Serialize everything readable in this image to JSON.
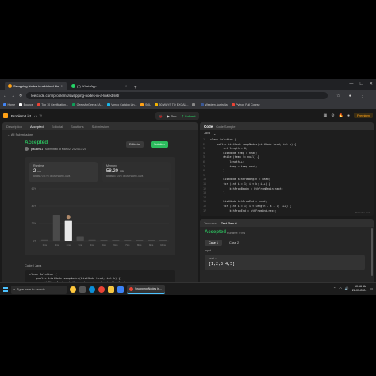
{
  "browser": {
    "tabs": [
      {
        "label": "Swapping Nodes in a Linked List",
        "active": true,
        "color": "#ffa116"
      },
      {
        "label": "(7) WhatsApp",
        "active": false,
        "color": "#25d366"
      }
    ],
    "new_tab": "+",
    "url": "leetcode.com/problems/swapping-nodes-in-a-linked-list/",
    "bookmarks": [
      {
        "label": "Home",
        "color": "#4285f4"
      },
      {
        "label": "Bounce",
        "color": "#ffffff"
      },
      {
        "label": "Top 10 Certification...",
        "color": "#ea4335"
      },
      {
        "label": "GeeksforGeeks | A...",
        "color": "#0f9d58"
      },
      {
        "label": "Vimeo Catalog Lin...",
        "color": "#1ab7ea"
      },
      {
        "label": "SQL",
        "color": "#ffa116"
      },
      {
        "label": "50 WAYS TO EXCAL...",
        "color": "#f4b400"
      },
      {
        "label": "",
        "color": "#888888"
      },
      {
        "label": "Western Australia",
        "color": "#3b5998"
      },
      {
        "label": "Python Full Course",
        "color": "#ea4335"
      }
    ]
  },
  "leetcode": {
    "problem_list": "Problem List",
    "run": "Run",
    "submit": "Submit",
    "premium": "Premium"
  },
  "left_panel": {
    "tabs": [
      "Description",
      "Accepted",
      "Editorial",
      "Solutions",
      "Submissions"
    ],
    "active_tab": 1,
    "all_submissions": "← All Submissions",
    "status": "Accepted",
    "author": "pisukm11",
    "submitted_at": "submitted at Mar 02, 2024 13:20",
    "editorial_btn": "Editorial",
    "solution_btn": "Solution",
    "runtime_label": "Runtime",
    "runtime_value": "2",
    "runtime_unit": "ms",
    "runtime_beats": "Beats 70.97% of users with Java",
    "memory_label": "Memory",
    "memory_value": "58.20",
    "memory_unit": "MB",
    "memory_beats": "Beats 87.04% of users with Java",
    "code_header": "Code | Java",
    "code_lines": [
      "class Solution {",
      "    public ListNode swapNodes(ListNode head, int k) {",
      "        // Step 1: Count the number of nodes in the list",
      "        int length = 0;",
      "        ListNode temp = head;",
      "        while (temp != null) {",
      "            length++;",
      "            temp = temp.next;"
    ]
  },
  "chart_data": {
    "type": "bar",
    "categories": [
      "0ms",
      "1ms",
      "2ms",
      "3ms",
      "4ms",
      "5ms",
      "6ms",
      "7ms",
      "8ms",
      "9ms",
      "10ms"
    ],
    "values": [
      2,
      30,
      24,
      5,
      2,
      1,
      1,
      1,
      1,
      1,
      1
    ],
    "highlight_index": 2,
    "yticks": [
      "60%",
      "40%",
      "20%",
      "0%"
    ],
    "ylim": [
      0,
      60
    ]
  },
  "code_panel": {
    "title": "Code",
    "subtitle": "Code Sample",
    "language": "Java",
    "saved": "Saved to local",
    "lines": [
      {
        "n": "1",
        "t": "class Solution {"
      },
      {
        "n": "2",
        "t": "    public ListNode swapNodes(ListNode head, int k) {"
      },
      {
        "n": "3",
        "t": "        int length = 0;"
      },
      {
        "n": "4",
        "t": "        ListNode temp = head;"
      },
      {
        "n": "5",
        "t": "        while (temp != null) {"
      },
      {
        "n": "6",
        "t": "            length++;"
      },
      {
        "n": "7",
        "t": "            temp = temp.next;"
      },
      {
        "n": "8",
        "t": "        }"
      },
      {
        "n": "9",
        "t": ""
      },
      {
        "n": "10",
        "t": "        ListNode kthFromBegin = head;"
      },
      {
        "n": "11",
        "t": "        for (int i = 1; i < k; i++) {"
      },
      {
        "n": "12",
        "t": "            kthFromBegin = kthFromBegin.next;"
      },
      {
        "n": "13",
        "t": "        }"
      },
      {
        "n": "14",
        "t": ""
      },
      {
        "n": "15",
        "t": "        ListNode kthFromEnd = head;"
      },
      {
        "n": "16",
        "t": "        for (int i = 1; i < length - k + 1; i++) {"
      },
      {
        "n": "17",
        "t": "            kthFromEnd = kthFromEnd.next;"
      }
    ]
  },
  "test_panel": {
    "tabs": [
      "Testcase",
      "Test Result"
    ],
    "active_tab": 1,
    "status": "Accepted",
    "runtime": "Runtime: 0 ms",
    "cases": [
      "Case 1",
      "Case 2"
    ],
    "input_label": "Input",
    "input_key": "head =",
    "input_value": "[1,2,3,4,5]"
  },
  "taskbar": {
    "search_placeholder": "Type here to search",
    "app_label": "Swapping Nodes in...",
    "time": "10:16 AM",
    "date": "28-03-2024"
  }
}
